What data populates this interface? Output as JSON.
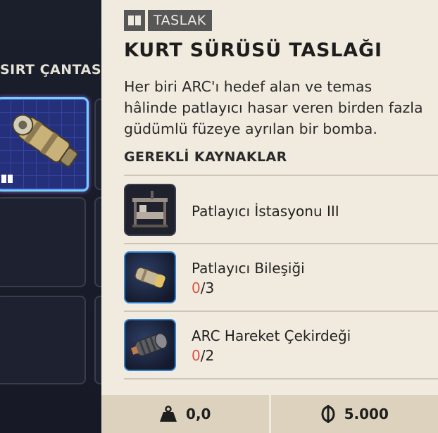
{
  "inventory": {
    "title": "SIRT ÇANTASI"
  },
  "detail": {
    "tag_icon": "book-icon",
    "tag_label": "TASLAK",
    "title": "KURT SÜRÜSÜ TASLAĞI",
    "description_lines": [
      "Her biri ARC'ı hedef alan ve temas",
      "hâlinde patlayıcı hasar veren birden fazla",
      "güdümlü füzeye ayrılan bir bomba."
    ],
    "required_title": "GEREKLİ KAYNAKLAR",
    "resources": [
      {
        "name": "Patlayıcı İstasyonu III",
        "icon": "workbench-icon"
      },
      {
        "name": "Patlayıcı Bileşiği",
        "have": "0",
        "need": "/3",
        "icon": "explosive-compound-icon"
      },
      {
        "name": "ARC Hareket Çekirdeği",
        "have": "0",
        "need": "/2",
        "icon": "arc-motion-core-icon"
      }
    ]
  },
  "footer": {
    "weight_icon": "weight-icon",
    "weight": "0,0",
    "price_icon": "coin-icon",
    "price": "5.000"
  },
  "colors": {
    "panel_bg": "#f1ebdf",
    "footer_bg": "#ddd2bd",
    "missing_qty": "#e0503e",
    "slot_highlight": "#6fd6ea"
  }
}
